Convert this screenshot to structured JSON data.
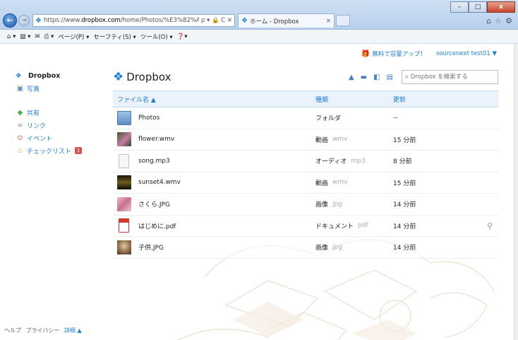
{
  "browser": {
    "url_prefix": "https://www.",
    "url_domain": "dropbox.com",
    "url_path": "/home/Photos/%E3%82%AD%E:",
    "url_tools": "ρ ▾ 🔒 C ✕",
    "tab_title": "ホーム - Dropbox",
    "tab_close": "×",
    "window_controls": {
      "minimize": "–",
      "maximize": "□",
      "close": "x"
    },
    "right_icons": {
      "home": "⌂",
      "favorites": "☆",
      "settings": "⚙"
    }
  },
  "command_bar": {
    "items": [
      "⌂ ▾",
      "▧ ▾",
      "✉",
      "⎙ ▾",
      "ページ(P) ▾",
      "セーフティ(S) ▾",
      "ツール(O) ▾",
      "❓▾"
    ]
  },
  "top_bar": {
    "upgrade": "無料で容量アップ！",
    "user": "sourcenext test01 ▼"
  },
  "sidebar": {
    "logo": "Dropbox",
    "items": [
      {
        "label": "写真",
        "icon": "photo-icon"
      },
      {
        "label": "共有",
        "icon": "share-icon"
      },
      {
        "label": "リンク",
        "icon": "link-icon"
      },
      {
        "label": "イベント",
        "icon": "event-icon"
      },
      {
        "label": "チェックリスト",
        "icon": "checklist-icon",
        "badge": "1"
      }
    ]
  },
  "footer": {
    "help": "ヘルプ",
    "privacy": "プライバシー",
    "more": "詳細 ▲"
  },
  "main": {
    "title": "Dropbox",
    "search_placeholder": "Dropbox を検索する",
    "columns": {
      "name": "ファイル名 ▲",
      "kind": "種類",
      "modified": "更新"
    },
    "files": [
      {
        "name": "Photos",
        "kind": "フォルダ",
        "ext": "",
        "modified": "--",
        "thumb": "folder"
      },
      {
        "name": "flower.wmv",
        "kind": "動画",
        "ext": "wmv",
        "modified": "15 分前",
        "thumb": "flower"
      },
      {
        "name": "song.mp3",
        "kind": "オーディオ",
        "ext": "mp3",
        "modified": "8 分前",
        "thumb": "audio"
      },
      {
        "name": "sunset4.wmv",
        "kind": "動画",
        "ext": "wmv",
        "modified": "15 分前",
        "thumb": "sunset"
      },
      {
        "name": "さくら.JPG",
        "kind": "画像",
        "ext": "jpg",
        "modified": "14 分前",
        "thumb": "sakura"
      },
      {
        "name": "はじめに.pdf",
        "kind": "ドキュメント",
        "ext": "pdf",
        "modified": "14 分前",
        "thumb": "pdf",
        "has_link": true
      },
      {
        "name": "子供.JPG",
        "kind": "画像",
        "ext": "jpg",
        "modified": "14 分前",
        "thumb": "child"
      }
    ]
  },
  "colors": {
    "accent": "#1f7ed6",
    "header_bg": "#eaf2fb",
    "badge": "#d9534f"
  }
}
